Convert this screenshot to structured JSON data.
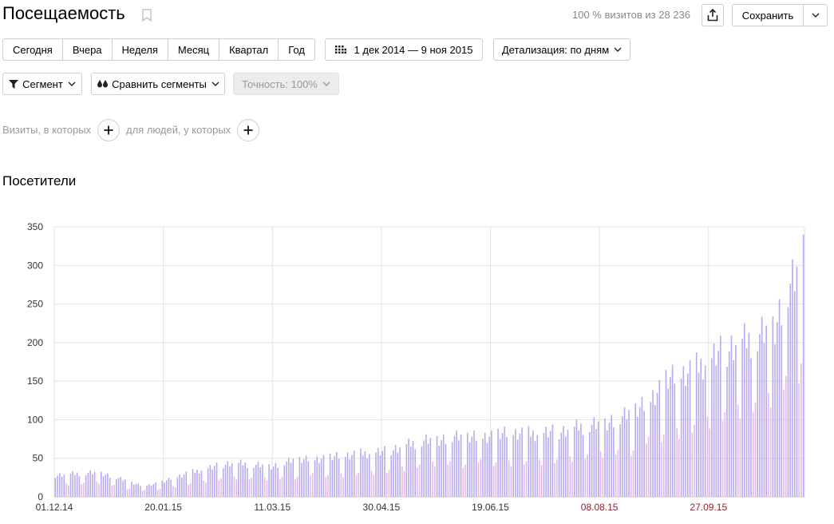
{
  "header": {
    "title": "Посещаемость",
    "stats": "100 % визитов из 28 236",
    "save_label": "Сохранить"
  },
  "periods": [
    "Сегодня",
    "Вчера",
    "Неделя",
    "Месяц",
    "Квартал",
    "Год"
  ],
  "date_range": "1 дек 2014 — 9 ноя 2015",
  "detail": "Детализация: по дням",
  "toolbar": {
    "segment": "Сегмент",
    "compare": "Сравнить сегменты",
    "accuracy": "Точность: 100%"
  },
  "filters": {
    "visits_label": "Визиты, в которых",
    "people_label": "для людей, у которых"
  },
  "section_title": "Посетители",
  "colors": {
    "bar": "#b9a9f0",
    "bar_secondary": "#e4b8ec",
    "holiday_tick": "#9b1c2c"
  },
  "chart_data": {
    "type": "bar",
    "title": "",
    "ylim": [
      0,
      350
    ],
    "y_ticks": [
      0,
      50,
      100,
      150,
      200,
      250,
      300,
      350
    ],
    "x_ticks": [
      {
        "label": "01.12.14",
        "day": 0,
        "highlight": false
      },
      {
        "label": "20.01.15",
        "day": 50,
        "highlight": false
      },
      {
        "label": "11.03.15",
        "day": 100,
        "highlight": false
      },
      {
        "label": "30.04.15",
        "day": 150,
        "highlight": false
      },
      {
        "label": "19.06.15",
        "day": 200,
        "highlight": false
      },
      {
        "label": "08.08.15",
        "day": 250,
        "highlight": true
      },
      {
        "label": "27.09.15",
        "day": 300,
        "highlight": true
      }
    ],
    "x_start": "2014-12-01",
    "x_end": "2015-11-09",
    "anchors": [
      [
        0,
        28
      ],
      [
        20,
        32
      ],
      [
        40,
        14
      ],
      [
        50,
        20
      ],
      [
        60,
        30
      ],
      [
        80,
        44
      ],
      [
        90,
        42
      ],
      [
        100,
        40
      ],
      [
        110,
        48
      ],
      [
        120,
        50
      ],
      [
        130,
        52
      ],
      [
        140,
        56
      ],
      [
        150,
        58
      ],
      [
        160,
        66
      ],
      [
        170,
        74
      ],
      [
        180,
        76
      ],
      [
        190,
        78
      ],
      [
        200,
        80
      ],
      [
        210,
        82
      ],
      [
        220,
        82
      ],
      [
        230,
        84
      ],
      [
        240,
        90
      ],
      [
        250,
        96
      ],
      [
        260,
        102
      ],
      [
        270,
        120
      ],
      [
        280,
        150
      ],
      [
        290,
        160
      ],
      [
        300,
        178
      ],
      [
        310,
        195
      ],
      [
        320,
        205
      ],
      [
        330,
        225
      ],
      [
        335,
        260
      ],
      [
        340,
        285
      ],
      [
        343,
        340
      ]
    ],
    "weekly_dip": 0.55,
    "grid": true,
    "legend": "none"
  }
}
